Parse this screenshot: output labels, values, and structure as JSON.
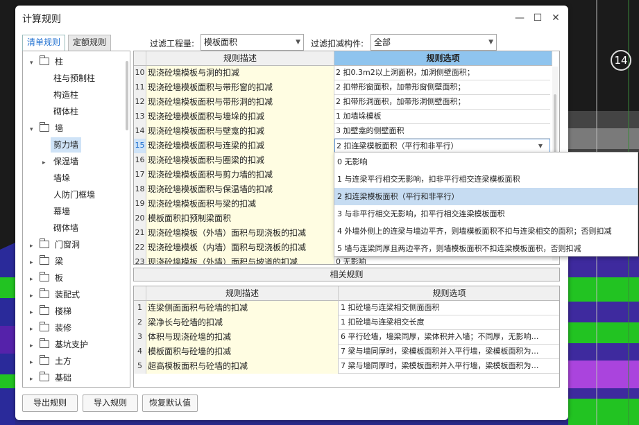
{
  "background": {
    "badge": "14"
  },
  "dialog": {
    "title": "计算规则",
    "minimize": "—",
    "maximize": "☐",
    "close": "✕",
    "tabs": [
      "清单规则",
      "定额规则"
    ],
    "filters": {
      "project_label": "过滤工程量:",
      "project_value": "模板面积",
      "component_label": "过滤扣减构件:",
      "component_value": "全部"
    },
    "tree": [
      {
        "label": "柱",
        "level": 0,
        "expander": "▾",
        "folder": true
      },
      {
        "label": "柱与预制柱",
        "level": 1
      },
      {
        "label": "构造柱",
        "level": 1
      },
      {
        "label": "砌体柱",
        "level": 1
      },
      {
        "label": "墙",
        "level": 0,
        "expander": "▾",
        "folder": true
      },
      {
        "label": "剪力墙",
        "level": 1,
        "selected": true
      },
      {
        "label": "保温墙",
        "level": 1,
        "expander": "▸"
      },
      {
        "label": "墙垛",
        "level": 1
      },
      {
        "label": "人防门框墙",
        "level": 1
      },
      {
        "label": "幕墙",
        "level": 1
      },
      {
        "label": "砌体墙",
        "level": 1
      },
      {
        "label": "门窗洞",
        "level": 0,
        "expander": "▸",
        "folder": true
      },
      {
        "label": "梁",
        "level": 0,
        "expander": "▸",
        "folder": true
      },
      {
        "label": "板",
        "level": 0,
        "expander": "▸",
        "folder": true
      },
      {
        "label": "装配式",
        "level": 0,
        "expander": "▸",
        "folder": true
      },
      {
        "label": "楼梯",
        "level": 0,
        "expander": "▸",
        "folder": true
      },
      {
        "label": "装修",
        "level": 0,
        "expander": "▸",
        "folder": true
      },
      {
        "label": "基坑支护",
        "level": 0,
        "expander": "▸",
        "folder": true
      },
      {
        "label": "土方",
        "level": 0,
        "expander": "▸",
        "folder": true
      },
      {
        "label": "基础",
        "level": 0,
        "expander": "▸",
        "folder": true
      }
    ],
    "grid": {
      "headers": {
        "desc": "规则描述",
        "option": "规则选项"
      },
      "rows": [
        {
          "num": "10",
          "desc": "现浇砼墙模板与洞的扣减",
          "option": "2  扣0.3m2以上洞面积，加洞侧壁面积；"
        },
        {
          "num": "11",
          "desc": "现浇砼墙模板面积与带形窗的扣减",
          "option": "2  扣带形窗面积，加带形窗侧壁面积；"
        },
        {
          "num": "12",
          "desc": "现浇砼墙模板面积与带形洞的扣减",
          "option": "2  扣带形洞面积，加带形洞侧壁面积；"
        },
        {
          "num": "13",
          "desc": "现浇砼墙模板面积与墙垛的扣减",
          "option": "1  加墙垛模板"
        },
        {
          "num": "14",
          "desc": "现浇砼墙模板面积与壁龛的扣减",
          "option": "3  加壁龛的侧壁面积"
        },
        {
          "num": "15",
          "desc": "现浇砼墙模板面积与连梁的扣减",
          "option": "2 扣连梁模板面积（平行和非平行）",
          "selected": true
        },
        {
          "num": "16",
          "desc": "现浇砼墙模板面积与圈梁的扣减",
          "option": ""
        },
        {
          "num": "17",
          "desc": "现浇砼墙模板面积与剪力墙的扣减",
          "option": ""
        },
        {
          "num": "18",
          "desc": "现浇砼墙模板面积与保温墙的扣减",
          "option": ""
        },
        {
          "num": "19",
          "desc": "现浇砼墙模板面积与梁的扣减",
          "option": ""
        },
        {
          "num": "20",
          "desc": "模板面积扣预制梁面积",
          "option": ""
        },
        {
          "num": "21",
          "desc": "现浇砼墙模板（外墙）面积与现浇板的扣减",
          "option": ""
        },
        {
          "num": "22",
          "desc": "现浇砼墙模板（内墙）面积与现浇板的扣减",
          "option": ""
        },
        {
          "num": "23",
          "desc": "现浇砼墙模板（外墙）面积与坡道的扣减",
          "option": "0  无影响"
        }
      ]
    },
    "dropdown": [
      {
        "text": "0  无影响"
      },
      {
        "text": "1 与连梁平行相交无影响，扣非平行相交连梁模板面积"
      },
      {
        "text": "2 扣连梁模板面积（平行和非平行）",
        "selected": true
      },
      {
        "text": "3 与非平行相交无影响，扣平行相交连梁模板面积"
      },
      {
        "text": "4 外墙外侧上的连梁与墙边平齐，则墙模板面积不扣与连梁相交的面积；否则扣减"
      },
      {
        "text": "5 墙与连梁同厚且两边平齐，则墙模板面积不扣连梁模板面积，否则扣减"
      }
    ],
    "related": {
      "bar_label": "相关规则",
      "headers": {
        "desc": "规则描述",
        "option": "规则选项"
      },
      "rows": [
        {
          "num": "1",
          "desc": "连梁侧面面积与砼墙的扣减",
          "option": "1 扣砼墙与连梁相交侧面面积"
        },
        {
          "num": "2",
          "desc": "梁净长与砼墙的扣减",
          "option": "1 扣砼墙与连梁相交长度"
        },
        {
          "num": "3",
          "desc": "体积与现浇砼墙的扣减",
          "option": "6 平行砼墙，墙梁同厚，梁体积并入墙；不同厚，无影响…"
        },
        {
          "num": "4",
          "desc": "模板面积与砼墙的扣减",
          "option": "7 梁与墙同厚时，梁模板面积并入平行墙，梁模板面积为…"
        },
        {
          "num": "5",
          "desc": "超高模板面积与砼墙的扣减",
          "option": "7 梁与墙同厚时，梁模板面积并入平行墙，梁模板面积为…"
        }
      ]
    },
    "buttons": {
      "export": "导出规则",
      "import": "导入规则",
      "restore": "恢复默认值"
    }
  }
}
